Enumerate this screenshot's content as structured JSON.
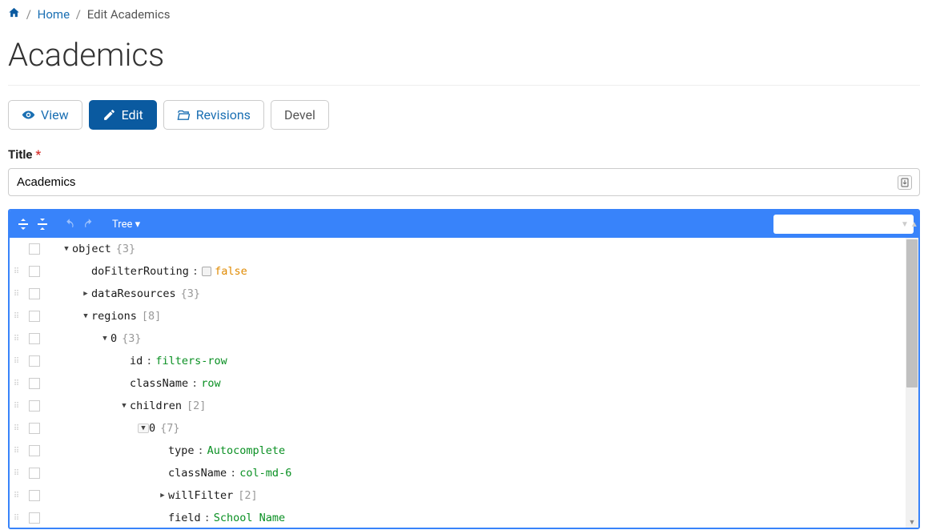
{
  "breadcrumb": {
    "home_link": "Home",
    "current": "Edit Academics"
  },
  "page_title": "Academics",
  "tabs": {
    "view": "View",
    "edit": "Edit",
    "revisions": "Revisions",
    "devel": "Devel"
  },
  "form": {
    "title_label": "Title",
    "title_value": "Academics"
  },
  "json_editor": {
    "mode_label": "Tree ▾",
    "search_placeholder": ""
  },
  "json_tree": {
    "root_label": "object",
    "root_count": "{3}",
    "rows": [
      {
        "no_drag": true,
        "indent": 0,
        "caret": "down",
        "key": "object",
        "meta": "{3}"
      },
      {
        "indent": 1,
        "caret": "",
        "key": "doFilterRouting",
        "colon": true,
        "val_bool": "false"
      },
      {
        "indent": 1,
        "caret": "right",
        "key": "dataResources",
        "meta": "{3}"
      },
      {
        "indent": 1,
        "caret": "down",
        "key": "regions",
        "meta": "[8]"
      },
      {
        "indent": 2,
        "caret": "down",
        "key": "0",
        "meta": "{3}"
      },
      {
        "indent": 3,
        "caret": "",
        "key": "id",
        "colon": true,
        "val_str": "filters-row"
      },
      {
        "indent": 3,
        "caret": "",
        "key": "className",
        "colon": true,
        "val_str": "row"
      },
      {
        "indent": 3,
        "caret": "down",
        "key": "children",
        "meta": "[2]"
      },
      {
        "indent": 4,
        "caret": "down",
        "caret_hl": true,
        "key": "0",
        "meta": "{7}"
      },
      {
        "indent": 5,
        "caret": "",
        "key": "type",
        "colon": true,
        "val_str": "Autocomplete"
      },
      {
        "indent": 5,
        "caret": "",
        "key": "className",
        "colon": true,
        "val_str": "col-md-6"
      },
      {
        "indent": 5,
        "caret": "right",
        "key": "willFilter",
        "meta": "[2]"
      },
      {
        "indent": 5,
        "caret": "",
        "key": "field",
        "colon": true,
        "val_str": "School Name"
      }
    ]
  }
}
